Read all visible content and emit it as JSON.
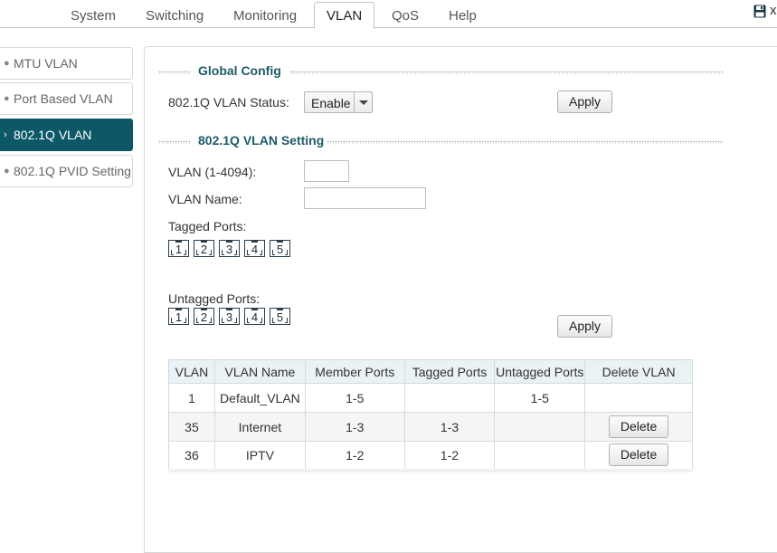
{
  "topnav": {
    "tabs": [
      {
        "label": "System"
      },
      {
        "label": "Switching"
      },
      {
        "label": "Monitoring"
      },
      {
        "label": "VLAN"
      },
      {
        "label": "QoS"
      },
      {
        "label": "Help"
      }
    ],
    "active_tab": "VLAN",
    "close_glyph": "x"
  },
  "sidebar": {
    "items": [
      {
        "label": "MTU VLAN"
      },
      {
        "label": "Port Based VLAN"
      },
      {
        "label": "802.1Q VLAN"
      },
      {
        "label": "802.1Q PVID Setting"
      }
    ],
    "active_item": "802.1Q VLAN"
  },
  "global_config": {
    "title": "Global Config",
    "status_label": "802.1Q VLAN Status:",
    "status_value": "Enable",
    "apply_label": "Apply"
  },
  "vlan_setting": {
    "title": "802.1Q VLAN Setting",
    "vlan_id_label": "VLAN (1-4094):",
    "vlan_id_value": "",
    "vlan_name_label": "VLAN Name:",
    "vlan_name_value": "",
    "tagged_label": "Tagged Ports:",
    "untagged_label": "Untagged Ports:",
    "ports": [
      "1",
      "2",
      "3",
      "4",
      "5"
    ],
    "apply_label": "Apply"
  },
  "vlan_table": {
    "headers": [
      "VLAN",
      "VLAN Name",
      "Member Ports",
      "Tagged Ports",
      "Untagged Ports",
      "Delete VLAN"
    ],
    "rows": [
      {
        "vlan": "1",
        "name": "Default_VLAN",
        "member": "1-5",
        "tagged": "",
        "untagged": "1-5",
        "delete": ""
      },
      {
        "vlan": "35",
        "name": "Internet",
        "member": "1-3",
        "tagged": "1-3",
        "untagged": "",
        "delete": "Delete"
      },
      {
        "vlan": "36",
        "name": "IPTV",
        "member": "1-2",
        "tagged": "1-2",
        "untagged": "",
        "delete": "Delete"
      }
    ]
  },
  "colors": {
    "accent": "#0d5866",
    "section_title": "#1d5b69",
    "table_header_bg": "#eaf2f5"
  }
}
